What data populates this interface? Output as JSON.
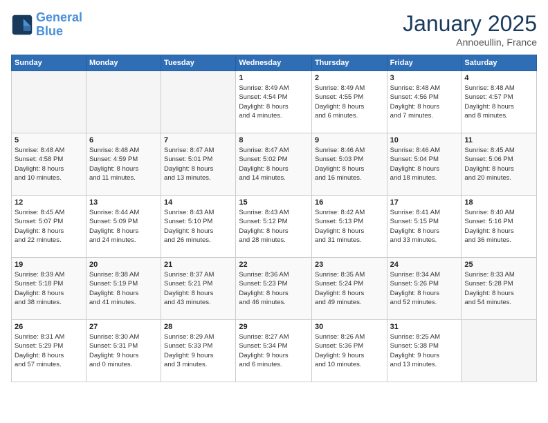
{
  "logo": {
    "line1": "General",
    "line2": "Blue"
  },
  "header": {
    "month": "January 2025",
    "location": "Annoeullin, France"
  },
  "weekdays": [
    "Sunday",
    "Monday",
    "Tuesday",
    "Wednesday",
    "Thursday",
    "Friday",
    "Saturday"
  ],
  "weeks": [
    [
      {
        "day": "",
        "info": ""
      },
      {
        "day": "",
        "info": ""
      },
      {
        "day": "",
        "info": ""
      },
      {
        "day": "1",
        "info": "Sunrise: 8:49 AM\nSunset: 4:54 PM\nDaylight: 8 hours\nand 4 minutes."
      },
      {
        "day": "2",
        "info": "Sunrise: 8:49 AM\nSunset: 4:55 PM\nDaylight: 8 hours\nand 6 minutes."
      },
      {
        "day": "3",
        "info": "Sunrise: 8:48 AM\nSunset: 4:56 PM\nDaylight: 8 hours\nand 7 minutes."
      },
      {
        "day": "4",
        "info": "Sunrise: 8:48 AM\nSunset: 4:57 PM\nDaylight: 8 hours\nand 8 minutes."
      }
    ],
    [
      {
        "day": "5",
        "info": "Sunrise: 8:48 AM\nSunset: 4:58 PM\nDaylight: 8 hours\nand 10 minutes."
      },
      {
        "day": "6",
        "info": "Sunrise: 8:48 AM\nSunset: 4:59 PM\nDaylight: 8 hours\nand 11 minutes."
      },
      {
        "day": "7",
        "info": "Sunrise: 8:47 AM\nSunset: 5:01 PM\nDaylight: 8 hours\nand 13 minutes."
      },
      {
        "day": "8",
        "info": "Sunrise: 8:47 AM\nSunset: 5:02 PM\nDaylight: 8 hours\nand 14 minutes."
      },
      {
        "day": "9",
        "info": "Sunrise: 8:46 AM\nSunset: 5:03 PM\nDaylight: 8 hours\nand 16 minutes."
      },
      {
        "day": "10",
        "info": "Sunrise: 8:46 AM\nSunset: 5:04 PM\nDaylight: 8 hours\nand 18 minutes."
      },
      {
        "day": "11",
        "info": "Sunrise: 8:45 AM\nSunset: 5:06 PM\nDaylight: 8 hours\nand 20 minutes."
      }
    ],
    [
      {
        "day": "12",
        "info": "Sunrise: 8:45 AM\nSunset: 5:07 PM\nDaylight: 8 hours\nand 22 minutes."
      },
      {
        "day": "13",
        "info": "Sunrise: 8:44 AM\nSunset: 5:09 PM\nDaylight: 8 hours\nand 24 minutes."
      },
      {
        "day": "14",
        "info": "Sunrise: 8:43 AM\nSunset: 5:10 PM\nDaylight: 8 hours\nand 26 minutes."
      },
      {
        "day": "15",
        "info": "Sunrise: 8:43 AM\nSunset: 5:12 PM\nDaylight: 8 hours\nand 28 minutes."
      },
      {
        "day": "16",
        "info": "Sunrise: 8:42 AM\nSunset: 5:13 PM\nDaylight: 8 hours\nand 31 minutes."
      },
      {
        "day": "17",
        "info": "Sunrise: 8:41 AM\nSunset: 5:15 PM\nDaylight: 8 hours\nand 33 minutes."
      },
      {
        "day": "18",
        "info": "Sunrise: 8:40 AM\nSunset: 5:16 PM\nDaylight: 8 hours\nand 36 minutes."
      }
    ],
    [
      {
        "day": "19",
        "info": "Sunrise: 8:39 AM\nSunset: 5:18 PM\nDaylight: 8 hours\nand 38 minutes."
      },
      {
        "day": "20",
        "info": "Sunrise: 8:38 AM\nSunset: 5:19 PM\nDaylight: 8 hours\nand 41 minutes."
      },
      {
        "day": "21",
        "info": "Sunrise: 8:37 AM\nSunset: 5:21 PM\nDaylight: 8 hours\nand 43 minutes."
      },
      {
        "day": "22",
        "info": "Sunrise: 8:36 AM\nSunset: 5:23 PM\nDaylight: 8 hours\nand 46 minutes."
      },
      {
        "day": "23",
        "info": "Sunrise: 8:35 AM\nSunset: 5:24 PM\nDaylight: 8 hours\nand 49 minutes."
      },
      {
        "day": "24",
        "info": "Sunrise: 8:34 AM\nSunset: 5:26 PM\nDaylight: 8 hours\nand 52 minutes."
      },
      {
        "day": "25",
        "info": "Sunrise: 8:33 AM\nSunset: 5:28 PM\nDaylight: 8 hours\nand 54 minutes."
      }
    ],
    [
      {
        "day": "26",
        "info": "Sunrise: 8:31 AM\nSunset: 5:29 PM\nDaylight: 8 hours\nand 57 minutes."
      },
      {
        "day": "27",
        "info": "Sunrise: 8:30 AM\nSunset: 5:31 PM\nDaylight: 9 hours\nand 0 minutes."
      },
      {
        "day": "28",
        "info": "Sunrise: 8:29 AM\nSunset: 5:33 PM\nDaylight: 9 hours\nand 3 minutes."
      },
      {
        "day": "29",
        "info": "Sunrise: 8:27 AM\nSunset: 5:34 PM\nDaylight: 9 hours\nand 6 minutes."
      },
      {
        "day": "30",
        "info": "Sunrise: 8:26 AM\nSunset: 5:36 PM\nDaylight: 9 hours\nand 10 minutes."
      },
      {
        "day": "31",
        "info": "Sunrise: 8:25 AM\nSunset: 5:38 PM\nDaylight: 9 hours\nand 13 minutes."
      },
      {
        "day": "",
        "info": ""
      }
    ]
  ]
}
